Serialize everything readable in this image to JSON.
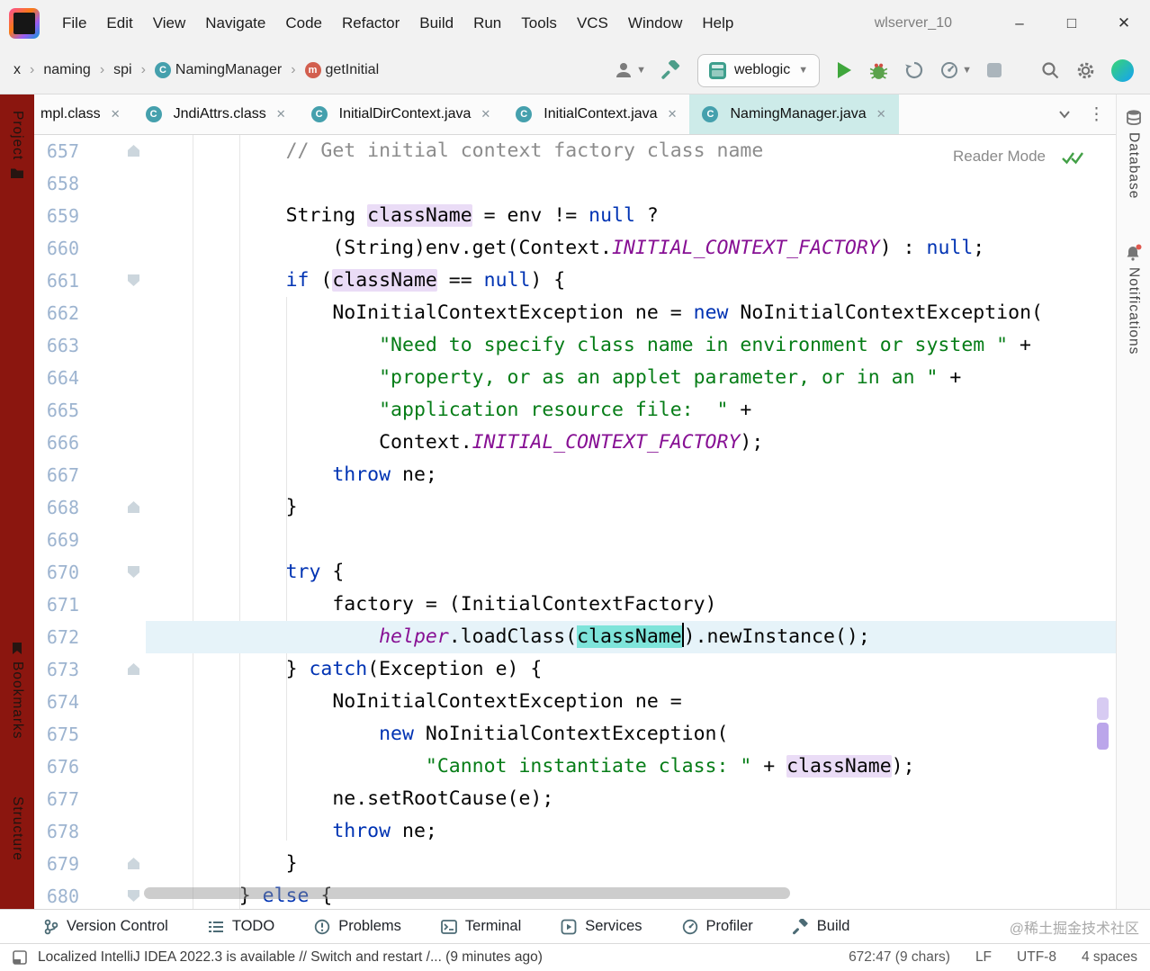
{
  "title_bar": {
    "menu": [
      "File",
      "Edit",
      "View",
      "Navigate",
      "Code",
      "Refactor",
      "Build",
      "Run",
      "Tools",
      "VCS",
      "Window",
      "Help"
    ],
    "project_title": "wlserver_10",
    "window_controls": {
      "minimize": "–",
      "maximize": "□",
      "close": "✕"
    }
  },
  "toolbar": {
    "breadcrumbs": [
      {
        "label": "x"
      },
      {
        "label": "naming"
      },
      {
        "label": "spi"
      },
      {
        "label": "NamingManager",
        "icon": "class-icon"
      },
      {
        "label": "getInitial",
        "icon": "method-icon"
      }
    ],
    "run_config": "weblogic"
  },
  "tabs": [
    {
      "label": "mpl.class"
    },
    {
      "label": "JndiAttrs.class",
      "icon": "class-icon"
    },
    {
      "label": "InitialDirContext.java",
      "icon": "class-icon"
    },
    {
      "label": "InitialContext.java",
      "icon": "class-icon"
    },
    {
      "label": "NamingManager.java",
      "icon": "class-icon",
      "active": true
    }
  ],
  "editor": {
    "reader_mode_label": "Reader Mode",
    "lines": [
      {
        "num": 657,
        "indent": 8,
        "fold": "up",
        "tokens": [
          {
            "s": "// Get initial context factory class name",
            "c": "cmt"
          }
        ]
      },
      {
        "num": 658,
        "indent": 0,
        "tokens": []
      },
      {
        "num": 659,
        "indent": 8,
        "tokens": [
          {
            "s": "String ",
            "c": "p"
          },
          {
            "s": "className",
            "c": "p",
            "bg": "occ"
          },
          {
            "s": " = env != ",
            "c": "p"
          },
          {
            "s": "null",
            "c": "kw"
          },
          {
            "s": " ?",
            "c": "p"
          }
        ]
      },
      {
        "num": 660,
        "indent": 12,
        "tokens": [
          {
            "s": "(String)env.get(Context.",
            "c": "p"
          },
          {
            "s": "INITIAL_CONTEXT_FACTORY",
            "c": "const"
          },
          {
            "s": ") : ",
            "c": "p"
          },
          {
            "s": "null",
            "c": "kw"
          },
          {
            "s": ";",
            "c": "p"
          }
        ]
      },
      {
        "num": 661,
        "indent": 8,
        "fold": "down",
        "tokens": [
          {
            "s": "if",
            "c": "kw"
          },
          {
            "s": " (",
            "c": "p"
          },
          {
            "s": "className",
            "c": "p",
            "bg": "occ"
          },
          {
            "s": " == ",
            "c": "p"
          },
          {
            "s": "null",
            "c": "kw"
          },
          {
            "s": ") {",
            "c": "p"
          }
        ]
      },
      {
        "num": 662,
        "indent": 12,
        "tokens": [
          {
            "s": "NoInitialContextException ne = ",
            "c": "p"
          },
          {
            "s": "new",
            "c": "kw"
          },
          {
            "s": " NoInitialContextException(",
            "c": "p"
          }
        ]
      },
      {
        "num": 663,
        "indent": 16,
        "tokens": [
          {
            "s": "\"Need to specify class name in environment or system \"",
            "c": "str"
          },
          {
            "s": " +",
            "c": "p"
          }
        ]
      },
      {
        "num": 664,
        "indent": 16,
        "tokens": [
          {
            "s": "\"property, or as an applet parameter, or in an \"",
            "c": "str"
          },
          {
            "s": " +",
            "c": "p"
          }
        ]
      },
      {
        "num": 665,
        "indent": 16,
        "tokens": [
          {
            "s": "\"application resource file:  \"",
            "c": "str"
          },
          {
            "s": " +",
            "c": "p"
          }
        ]
      },
      {
        "num": 666,
        "indent": 16,
        "tokens": [
          {
            "s": "Context.",
            "c": "p"
          },
          {
            "s": "INITIAL_CONTEXT_FACTORY",
            "c": "const"
          },
          {
            "s": ");",
            "c": "p"
          }
        ]
      },
      {
        "num": 667,
        "indent": 12,
        "tokens": [
          {
            "s": "throw",
            "c": "kw"
          },
          {
            "s": " ne;",
            "c": "p"
          }
        ]
      },
      {
        "num": 668,
        "indent": 8,
        "fold": "up",
        "tokens": [
          {
            "s": "}",
            "c": "p"
          }
        ]
      },
      {
        "num": 669,
        "indent": 0,
        "tokens": []
      },
      {
        "num": 670,
        "indent": 8,
        "fold": "down",
        "tokens": [
          {
            "s": "try",
            "c": "kw"
          },
          {
            "s": " {",
            "c": "p"
          }
        ]
      },
      {
        "num": 671,
        "indent": 12,
        "tokens": [
          {
            "s": "factory = (InitialContextFactory)",
            "c": "p"
          }
        ]
      },
      {
        "num": 672,
        "indent": 16,
        "current": true,
        "tokens": [
          {
            "s": "helper",
            "c": "field"
          },
          {
            "s": ".loadClass(",
            "c": "p"
          },
          {
            "s": "className",
            "c": "p",
            "bg": "sel",
            "caret": true
          },
          {
            "s": ").newInstance();",
            "c": "p"
          }
        ]
      },
      {
        "num": 673,
        "indent": 8,
        "fold": "up",
        "tokens": [
          {
            "s": "} ",
            "c": "p"
          },
          {
            "s": "catch",
            "c": "kw"
          },
          {
            "s": "(Exception e) {",
            "c": "p"
          }
        ]
      },
      {
        "num": 674,
        "indent": 12,
        "tokens": [
          {
            "s": "NoInitialContextException ne =",
            "c": "p"
          }
        ]
      },
      {
        "num": 675,
        "indent": 16,
        "tokens": [
          {
            "s": "new",
            "c": "kw"
          },
          {
            "s": " NoInitialContextException(",
            "c": "p"
          }
        ]
      },
      {
        "num": 676,
        "indent": 20,
        "tokens": [
          {
            "s": "\"Cannot instantiate class: \"",
            "c": "str"
          },
          {
            "s": " + ",
            "c": "p"
          },
          {
            "s": "className",
            "c": "p",
            "bg": "occ"
          },
          {
            "s": ");",
            "c": "p"
          }
        ]
      },
      {
        "num": 677,
        "indent": 12,
        "tokens": [
          {
            "s": "ne.setRootCause(e);",
            "c": "p"
          }
        ]
      },
      {
        "num": 678,
        "indent": 12,
        "tokens": [
          {
            "s": "throw",
            "c": "kw"
          },
          {
            "s": " ne;",
            "c": "p"
          }
        ]
      },
      {
        "num": 679,
        "indent": 8,
        "fold": "up",
        "tokens": [
          {
            "s": "}",
            "c": "p"
          }
        ]
      },
      {
        "num": 680,
        "indent": 4,
        "fold": "down",
        "tokens": [
          {
            "s": "} ",
            "c": "p"
          },
          {
            "s": "else",
            "c": "kw"
          },
          {
            "s": " {",
            "c": "p"
          }
        ]
      }
    ]
  },
  "tool_strips": {
    "left": [
      "Project",
      "Bookmarks",
      "Structure"
    ],
    "right": [
      "Database",
      "Notifications"
    ]
  },
  "bottom_bar": {
    "items": [
      "Version Control",
      "TODO",
      "Problems",
      "Terminal",
      "Services",
      "Profiler",
      "Build"
    ],
    "watermark": "@稀土掘金技术社区"
  },
  "status_bar": {
    "message": "Localized IntelliJ IDEA 2022.3 is available // Switch and restart /... (9 minutes ago)",
    "caret_position": "672:47 (9 chars)",
    "line_separator": "LF",
    "encoding": "UTF-8",
    "indent_info": "4 spaces"
  },
  "colors": {
    "active_tab": "#cdebe9",
    "left_strip": "#8b160f",
    "selection": "#7ee4da",
    "occurrence_highlight": "#eadcf6",
    "current_line": "#e6f3f9",
    "keyword": "#0033b3",
    "string": "#067d17",
    "comment": "#8c8c8c",
    "constant": "#871094",
    "run_green": "#3fa63c"
  }
}
